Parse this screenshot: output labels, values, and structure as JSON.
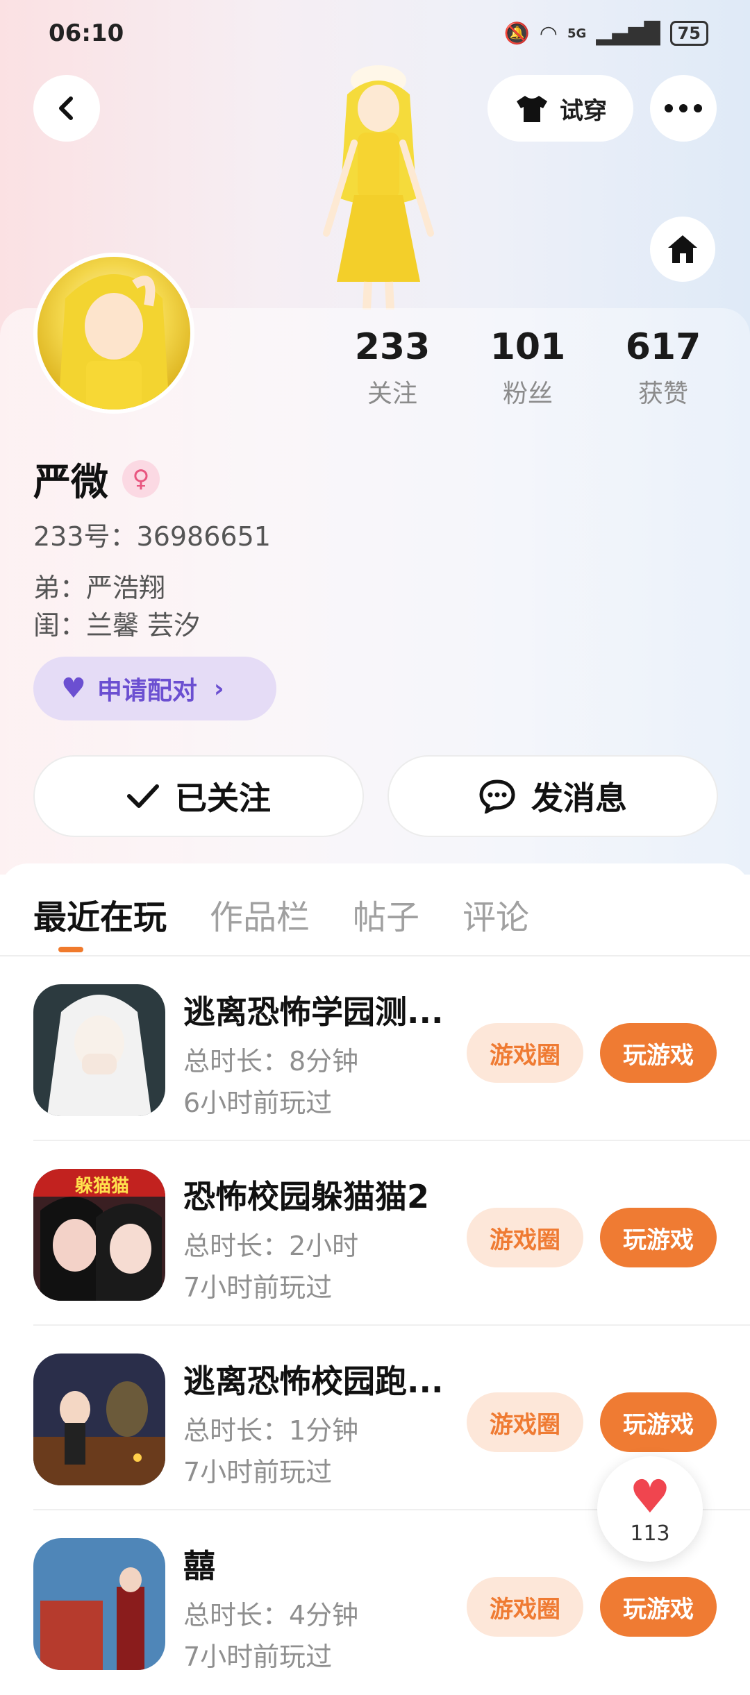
{
  "status": {
    "time": "06:10",
    "network": "5G",
    "battery": "75"
  },
  "header": {
    "try_on_label": "试穿"
  },
  "profile": {
    "name": "严微",
    "uid": "233号：36986651",
    "relation1": "弟：严浩翔",
    "relation2": "闺：兰馨 芸汐",
    "stats": [
      {
        "value": "233",
        "label": "关注"
      },
      {
        "value": "101",
        "label": "粉丝"
      },
      {
        "value": "617",
        "label": "获赞"
      }
    ],
    "pair_label": "申请配对",
    "follow_label": "已关注",
    "message_label": "发消息"
  },
  "tabs": [
    {
      "label": "最近在玩",
      "active": true
    },
    {
      "label": "作品栏",
      "active": false
    },
    {
      "label": "帖子",
      "active": false
    },
    {
      "label": "评论",
      "active": false
    }
  ],
  "games": [
    {
      "title": "逃离恐怖学园测...",
      "duration": "总时长：8分钟",
      "last_played": "6小时前玩过",
      "circle_label": "游戏圈",
      "play_label": "玩游戏"
    },
    {
      "title": "恐怖校园躲猫猫2",
      "duration": "总时长：2小时",
      "last_played": "7小时前玩过",
      "circle_label": "游戏圈",
      "play_label": "玩游戏",
      "icon_text": "躲猫猫"
    },
    {
      "title": "逃离恐怖校园跑...",
      "duration": "总时长：1分钟",
      "last_played": "7小时前玩过",
      "circle_label": "游戏圈",
      "play_label": "玩游戏"
    },
    {
      "title": "囍",
      "duration": "总时长：4分钟",
      "last_played": "7小时前玩过",
      "circle_label": "游戏圈",
      "play_label": "玩游戏"
    }
  ],
  "like_widget": {
    "count": "113"
  },
  "colors": {
    "accent": "#ef7b33",
    "pair": "#6b4fd1",
    "like": "#f0454f"
  }
}
